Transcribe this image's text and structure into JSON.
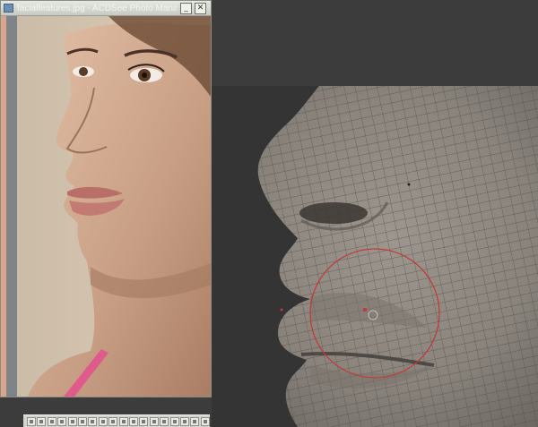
{
  "reference_window": {
    "title": "facialfeatures.jpg - ACDSee Photo Mana...",
    "minimize_icon": "minimize-icon",
    "close_icon": "close-icon",
    "image_label": "reference-photo"
  },
  "viewport": {
    "mesh_label": "3d-nose-lips-mesh",
    "brush": "sculpt-brush-cursor"
  },
  "toolbar": {
    "buttons": [
      "tool-1",
      "tool-2",
      "tool-3",
      "tool-4",
      "tool-5",
      "tool-6",
      "tool-7",
      "tool-8",
      "tool-9",
      "tool-10",
      "tool-11",
      "tool-12",
      "tool-13",
      "tool-14",
      "tool-15",
      "tool-16",
      "tool-17",
      "tool-18"
    ]
  },
  "colors": {
    "mesh_face": "#8d8780",
    "mesh_line": "#4a4744",
    "brush_circle": "#c23a3a",
    "skin": "#c8a28a",
    "photo_bg": "#d8c6b0"
  }
}
